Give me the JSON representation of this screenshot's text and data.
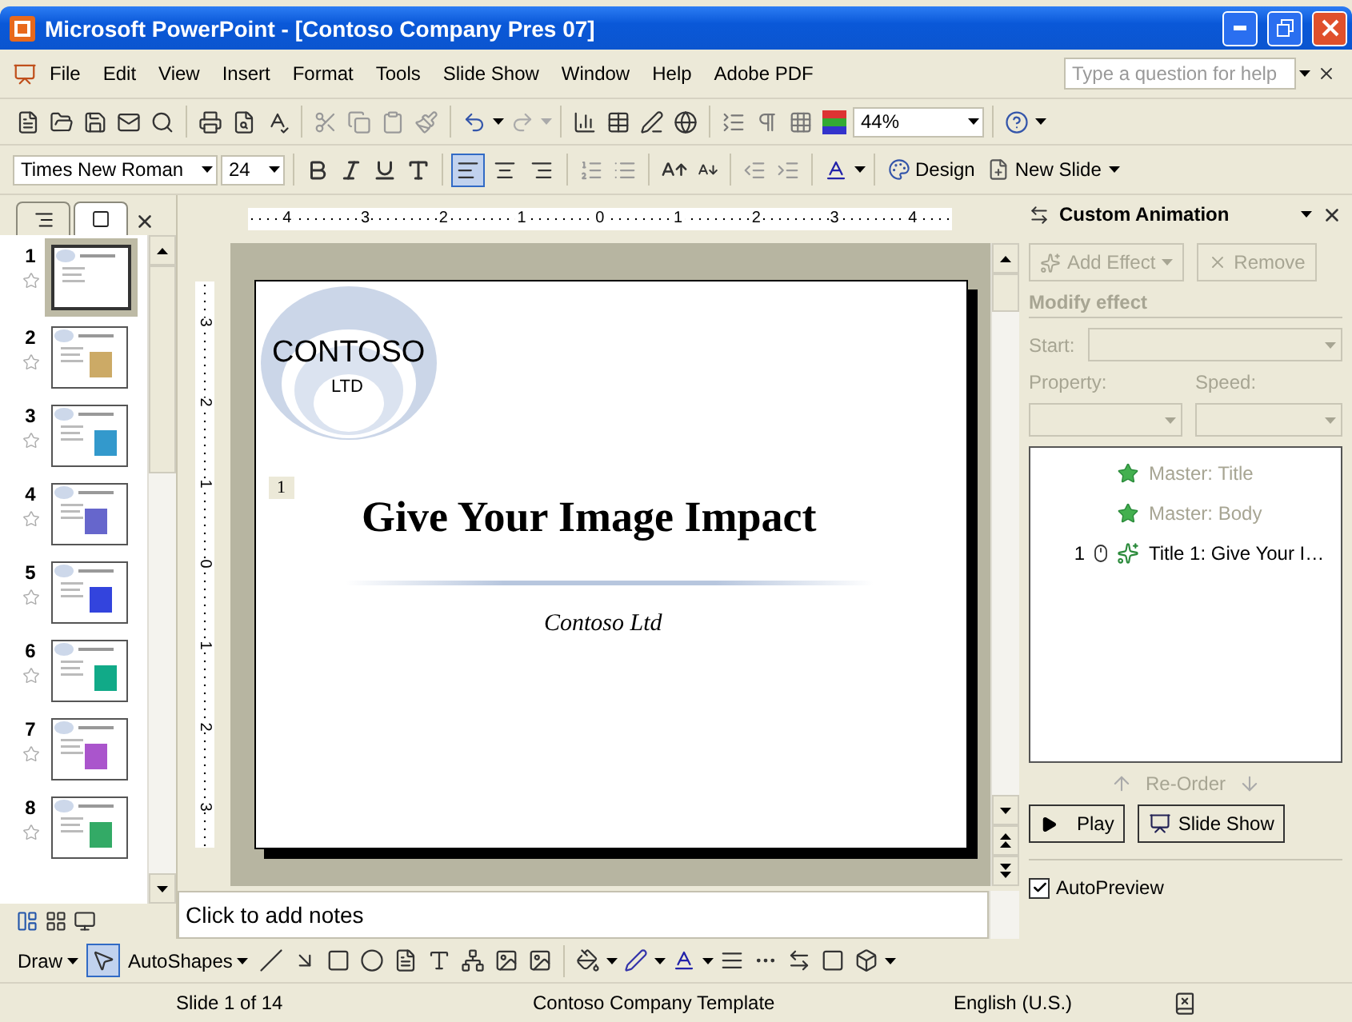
{
  "window": {
    "title": "Microsoft PowerPoint - [Contoso Company Pres 07]"
  },
  "menu": [
    "File",
    "Edit",
    "View",
    "Insert",
    "Format",
    "Tools",
    "Slide Show",
    "Window",
    "Help",
    "Adobe PDF"
  ],
  "help_box": {
    "placeholder": "Type a question for help"
  },
  "standard_toolbar": {
    "zoom": "44%"
  },
  "formatting_toolbar": {
    "font": "Times New Roman",
    "size": "24",
    "align_buttons": [
      {
        "selected": true
      },
      {
        "selected": false
      },
      {
        "selected": false
      }
    ],
    "design": "Design",
    "new_slide": "New Slide"
  },
  "slides_pane": {
    "tabs": [
      {
        "selected": false
      },
      {
        "selected": true
      }
    ],
    "thumbnails": [
      {
        "number": "1",
        "selected": true
      },
      {
        "number": "2",
        "selected": false
      },
      {
        "number": "3",
        "selected": false
      },
      {
        "number": "4",
        "selected": false
      },
      {
        "number": "5",
        "selected": false
      },
      {
        "number": "6",
        "selected": false
      },
      {
        "number": "7",
        "selected": false
      },
      {
        "number": "8",
        "selected": false
      }
    ]
  },
  "rulers": {
    "horizontal": [
      "4",
      "3",
      "2",
      "1",
      "0",
      "1",
      "2",
      "3",
      "4"
    ],
    "vertical": [
      "3",
      "2",
      "1",
      "0",
      "1",
      "2",
      "3"
    ]
  },
  "slide": {
    "logo_name": "CONTOSO",
    "logo_sub": "LTD",
    "number": "1",
    "title": "Give Your Image Impact",
    "subtitle": "Contoso Ltd"
  },
  "notes": {
    "placeholder": "Click to add notes"
  },
  "task_pane": {
    "title": "Custom Animation",
    "add_effect": {
      "label": "Add Effect",
      "disabled": true
    },
    "remove": {
      "label": "Remove",
      "disabled": true
    },
    "section": "Modify effect",
    "start": "Start:",
    "property": "Property:",
    "speed": "Speed:",
    "effects": [
      {
        "kind": "master",
        "name": "Master: Title",
        "disabled": true
      },
      {
        "kind": "master",
        "name": "Master: Body",
        "disabled": true
      },
      {
        "kind": "on_click",
        "order": "1",
        "name": "Title 1: Give Your I…",
        "disabled": false
      }
    ],
    "reorder": "Re-Order",
    "play": "Play",
    "slide_show": "Slide Show",
    "autopreview": {
      "label": "AutoPreview",
      "checked": true
    }
  },
  "draw_toolbar": {
    "draw": "Draw",
    "autoshapes": "AutoShapes"
  },
  "status_bar": [
    "Slide 1 of 14",
    "Contoso Company Template",
    "English (U.S.)"
  ]
}
